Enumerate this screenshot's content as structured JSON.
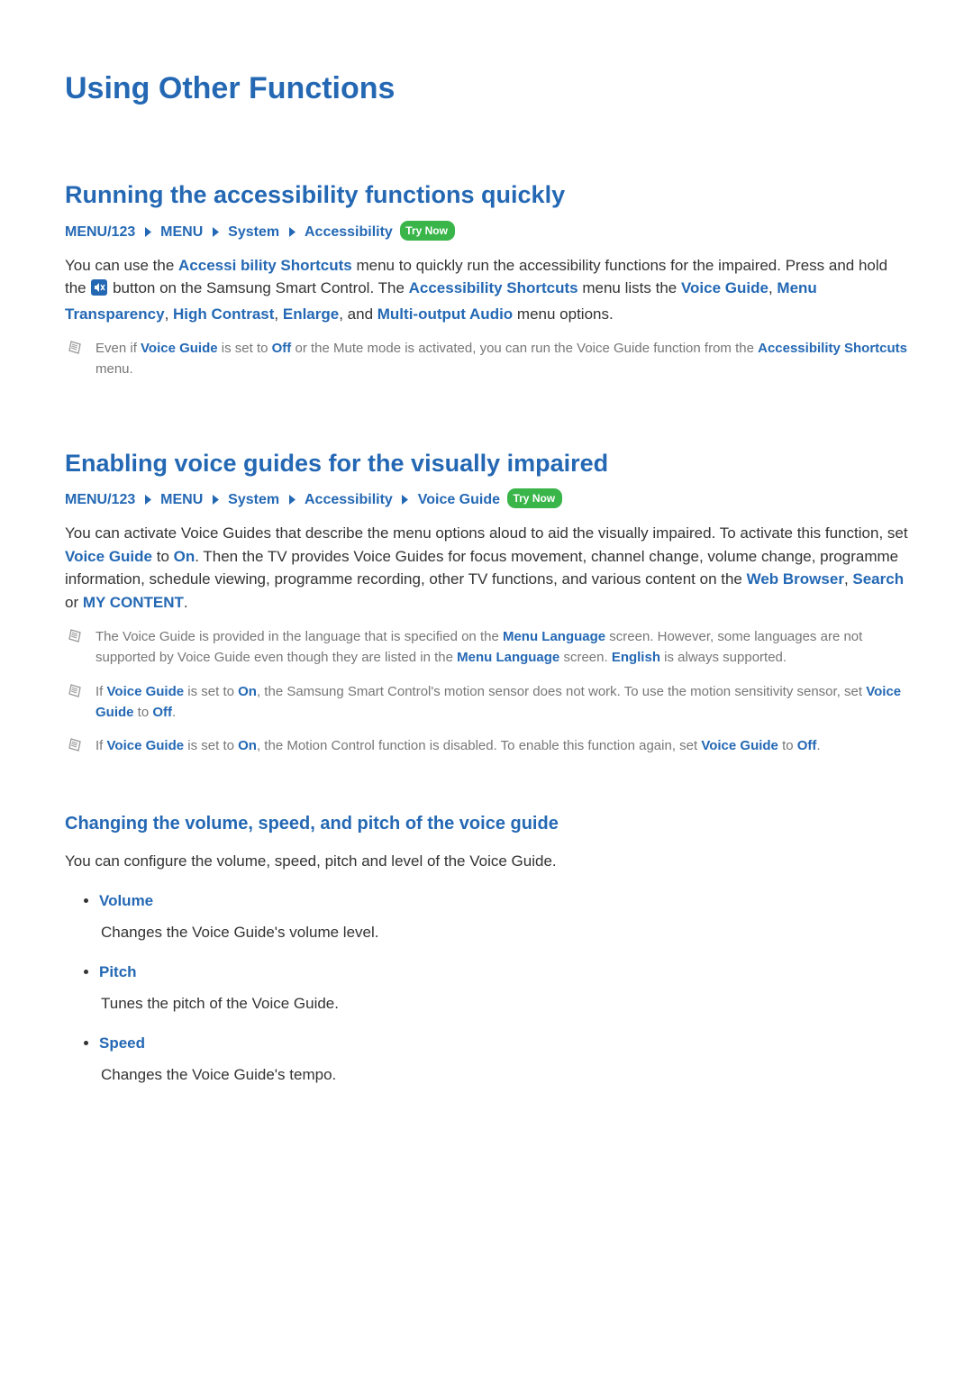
{
  "page_title": "Using Other Functions",
  "try_now_label": "Try Now",
  "section1": {
    "heading": "Running the accessibility functions quickly",
    "crumbs": [
      "MENU/123",
      "MENU",
      "System",
      "Accessibility"
    ],
    "p_a": "You can use the ",
    "p_b": "Accessi bility Shortcuts",
    "p_c": " menu to quickly run the accessibility functions for the impaired. Press and hold the ",
    "p_d": " button on the Samsung Smart Control. The ",
    "p_e": "Accessibility Shortcuts",
    "p_f": " menu lists the ",
    "p_g": "Voice Guide",
    "p_h": ", ",
    "p_i": "Menu Transparency",
    "p_j": ", ",
    "p_k": "High Contrast",
    "p_l": ", ",
    "p_m": "Enlarge",
    "p_n": ", and ",
    "p_o": "Multi-output Audio",
    "p_p": " menu options.",
    "note": {
      "a": "Even if ",
      "b": "Voice Guide",
      "c": " is set to ",
      "d": "Off",
      "e": " or the Mute mode is activated, you can run the Voice Guide function from the ",
      "f": "Accessibility Shortcuts",
      "g": " menu."
    }
  },
  "section2": {
    "heading": "Enabling voice guides for the visually impaired",
    "crumbs": [
      "MENU/123",
      "MENU",
      "System",
      "Accessibility",
      "Voice Guide"
    ],
    "p_a": "You can activate Voice Guides that describe the menu options aloud to aid the visually impaired. To activate this function, set ",
    "p_b": "Voice Guide",
    "p_c": " to ",
    "p_d": "On",
    "p_e": ". Then the TV provides Voice Guides for focus movement, channel change, volume change, programme information, schedule viewing, programme recording, other TV functions, and various content on the ",
    "p_f": "Web Browser",
    "p_g": ", ",
    "p_h": "Search",
    "p_i": " or ",
    "p_j": "MY CONTENT",
    "p_k": ".",
    "note1": {
      "a": "The Voice Guide is provided in the language that is specified on the ",
      "b": "Menu Language",
      "c": " screen. However, some languages are not supported by Voice Guide even though they are listed in the ",
      "d": "Menu Language",
      "e": " screen. ",
      "f": "English",
      "g": " is always supported."
    },
    "note2": {
      "a": "If ",
      "b": "Voice Guide",
      "c": " is set to ",
      "d": "On",
      "e": ", the Samsung Smart Control's motion sensor does not work. To use the motion sensitivity sensor, set ",
      "f": "Voice Guide",
      "g": " to ",
      "h": "Off",
      "i": "."
    },
    "note3": {
      "a": "If ",
      "b": "Voice Guide",
      "c": " is set to ",
      "d": "On",
      "e": ", the Motion Control function is disabled. To enable this function again, set  ",
      "f": "Voice Guide",
      "g": " to ",
      "h": "Off",
      "i": "."
    }
  },
  "section3": {
    "heading": "Changing the volume, speed, and pitch of the voice guide",
    "intro": "You can configure the volume, speed, pitch and level of the Voice Guide.",
    "opts": [
      {
        "name": "Volume",
        "desc": "Changes the Voice Guide's volume level."
      },
      {
        "name": "Pitch",
        "desc": "Tunes the pitch of the Voice Guide."
      },
      {
        "name": "Speed",
        "desc": "Changes the Voice Guide's tempo."
      }
    ]
  }
}
